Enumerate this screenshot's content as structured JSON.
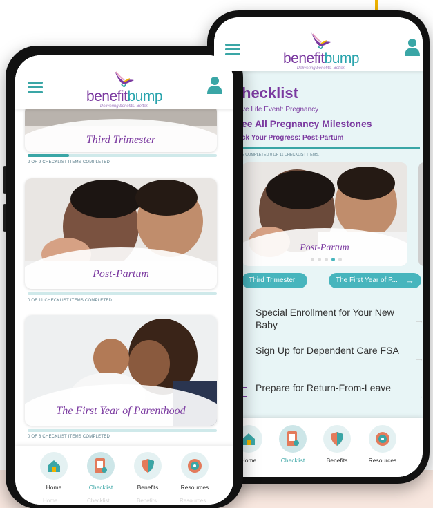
{
  "app": {
    "brand_primary": "benefit",
    "brand_secondary": "bump",
    "tagline": "Delivering benefits. Better."
  },
  "colors": {
    "teal": "#3aa6a6",
    "purple": "#7b3aa0",
    "pink_band": "#f8e7df",
    "accent": "#f0b400"
  },
  "front": {
    "cards": [
      {
        "title": "Third Trimester",
        "progress_text": "2 OF 9 CHECKLIST ITEMS COMPLETED",
        "progress": 0.22
      },
      {
        "title": "Post-Partum",
        "progress_text": "0 OF 11 CHECKLIST ITEMS COMPLETED",
        "progress": 0
      },
      {
        "title": "The First Year of Parenthood",
        "progress_text": "0 OF 8 CHECKLIST ITEMS COMPLETED",
        "progress": 0
      }
    ],
    "nav": [
      {
        "label": "Home",
        "icon": "home-icon"
      },
      {
        "label": "Checklist",
        "icon": "checklist-icon",
        "active": true
      },
      {
        "label": "Benefits",
        "icon": "shield-icon"
      },
      {
        "label": "Resources",
        "icon": "resources-icon"
      }
    ],
    "nav_peek": [
      "Home",
      "Checklist",
      "Benefits",
      "Resources"
    ]
  },
  "back": {
    "title": "hecklist",
    "life_event": "ve Life Event: Pregnancy",
    "see_all": "ee All Pregnancy Milestones",
    "track": "ck Your Progress: Post-Partum",
    "progress_text": "E COMPLETED 0 OF 11 CHECKLIST ITEMS.",
    "carousel_card_title": "Post-Partum",
    "prev_pill": "Third Trimester",
    "next_pill": "The First Year of P...",
    "next_arrow": "→",
    "items": [
      {
        "text": "Special Enrollment for Your New Baby"
      },
      {
        "text": "Sign Up for Dependent Care FSA"
      },
      {
        "text": "Prepare for Return-From-Leave"
      }
    ],
    "item_arrow": "→",
    "nav": [
      {
        "label": "Home",
        "icon": "home-icon"
      },
      {
        "label": "Checklist",
        "icon": "checklist-icon",
        "active": true
      },
      {
        "label": "Benefits",
        "icon": "shield-icon"
      },
      {
        "label": "Resources",
        "icon": "resources-icon"
      }
    ]
  }
}
